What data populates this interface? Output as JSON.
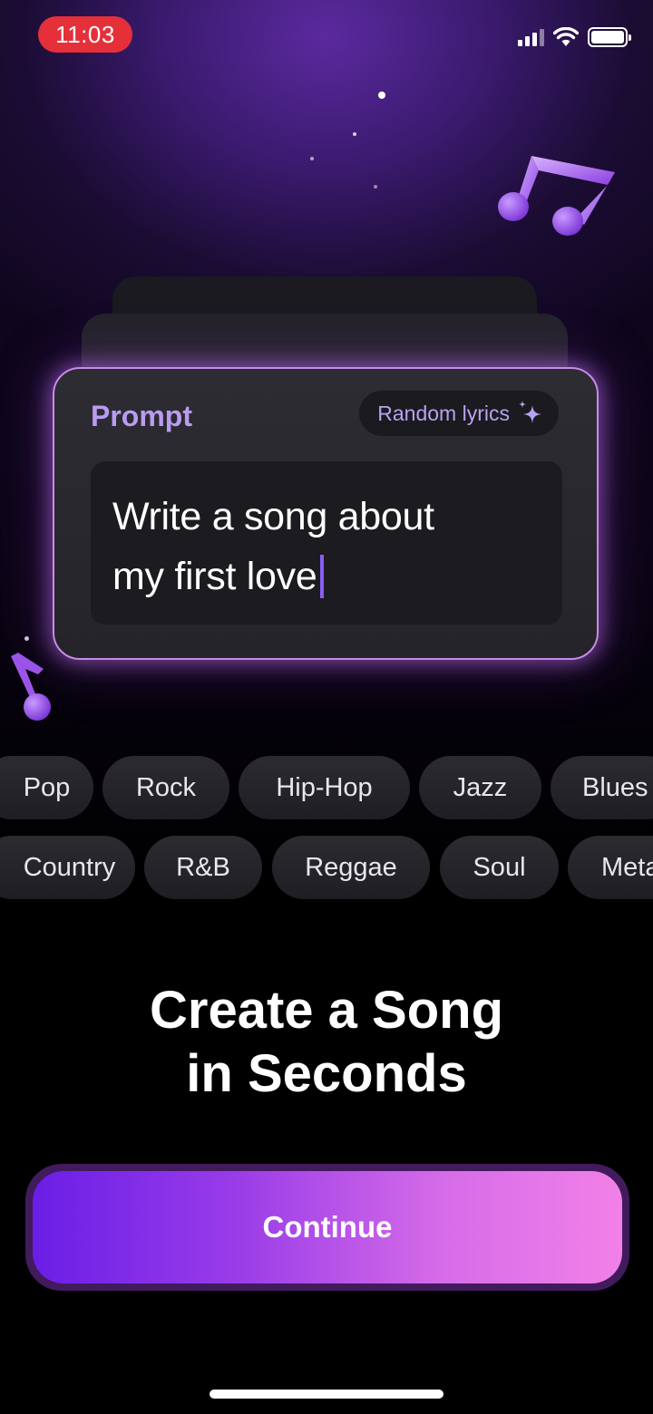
{
  "status_bar": {
    "time": "11:03",
    "time_pill_color": "#e5303a",
    "icons": [
      "signal-icon",
      "wifi-icon",
      "battery-icon"
    ]
  },
  "prompt_card": {
    "label": "Prompt",
    "random_button_label": "Random lyrics",
    "random_button_icon": "sparkle-icon",
    "prompt_text": "Write a song about my first love",
    "border_color": "#c98be8"
  },
  "genres": {
    "row1": [
      "Pop",
      "Rock",
      "Hip-Hop",
      "Jazz",
      "Blues"
    ],
    "row2": [
      "Country",
      "R&B",
      "Reggae",
      "Soul",
      "Meta"
    ]
  },
  "headline": {
    "line1": "Create a Song",
    "line2": "in Seconds"
  },
  "continue_button": {
    "label": "Continue",
    "gradient": [
      "#6a1ee6",
      "#f280e8"
    ]
  },
  "decorations": [
    "music-note-icon",
    "music-note-small-icon"
  ]
}
